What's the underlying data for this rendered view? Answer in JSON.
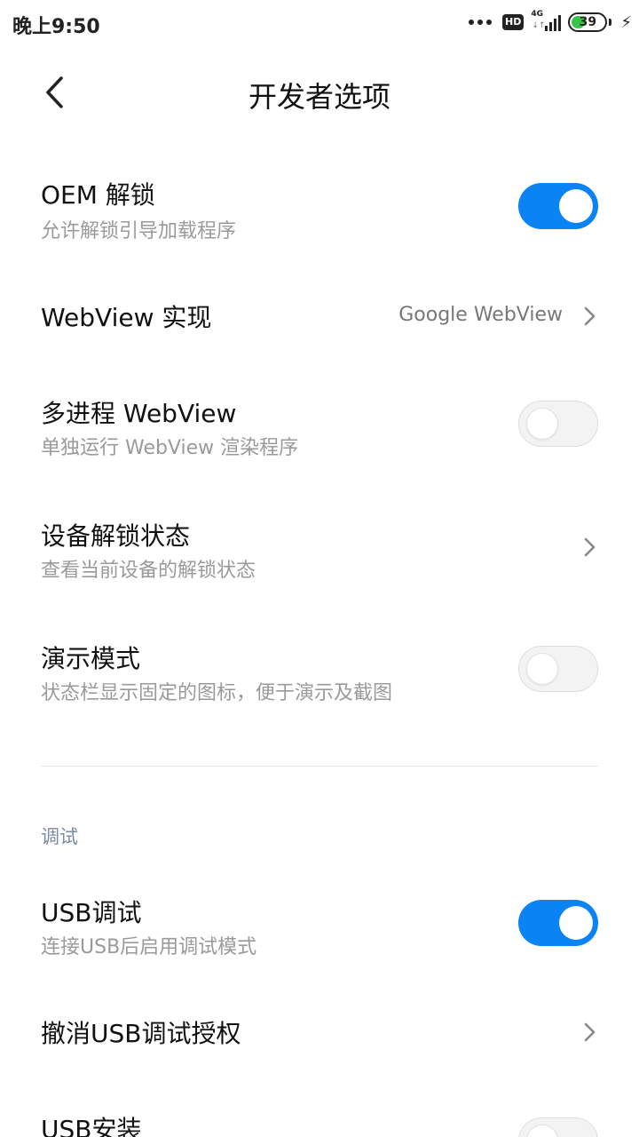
{
  "status_bar": {
    "time": "晚上9:50",
    "hd_label": "HD",
    "network_label": "4G",
    "battery_level": "39",
    "battery_fraction": 0.39
  },
  "header": {
    "title": "开发者选项"
  },
  "items": [
    {
      "title": "OEM 解锁",
      "subtitle": "允许解锁引导加载程序",
      "control": "toggle",
      "state": "on"
    },
    {
      "title": "WebView 实现",
      "value": "Google WebView",
      "control": "chevron"
    },
    {
      "title": "多进程 WebView",
      "subtitle": "单独运行 WebView 渲染程序",
      "control": "toggle",
      "state": "off"
    },
    {
      "title": "设备解锁状态",
      "subtitle": "查看当前设备的解锁状态",
      "control": "chevron"
    },
    {
      "title": "演示模式",
      "subtitle": "状态栏显示固定的图标，便于演示及截图",
      "control": "toggle",
      "state": "off"
    }
  ],
  "debug_section": {
    "header": "调试",
    "items": [
      {
        "title": "USB调试",
        "subtitle": "连接USB后启用调试模式",
        "control": "toggle",
        "state": "on"
      },
      {
        "title": "撤消USB调试授权",
        "control": "chevron"
      },
      {
        "title": "USB安装",
        "control": "toggle",
        "state": "off"
      }
    ]
  },
  "colors": {
    "accent": "#0a84f5",
    "subtitle_text": "#9a9a9a",
    "section_header": "#7a8aa3",
    "battery_fill": "#39c34a"
  }
}
